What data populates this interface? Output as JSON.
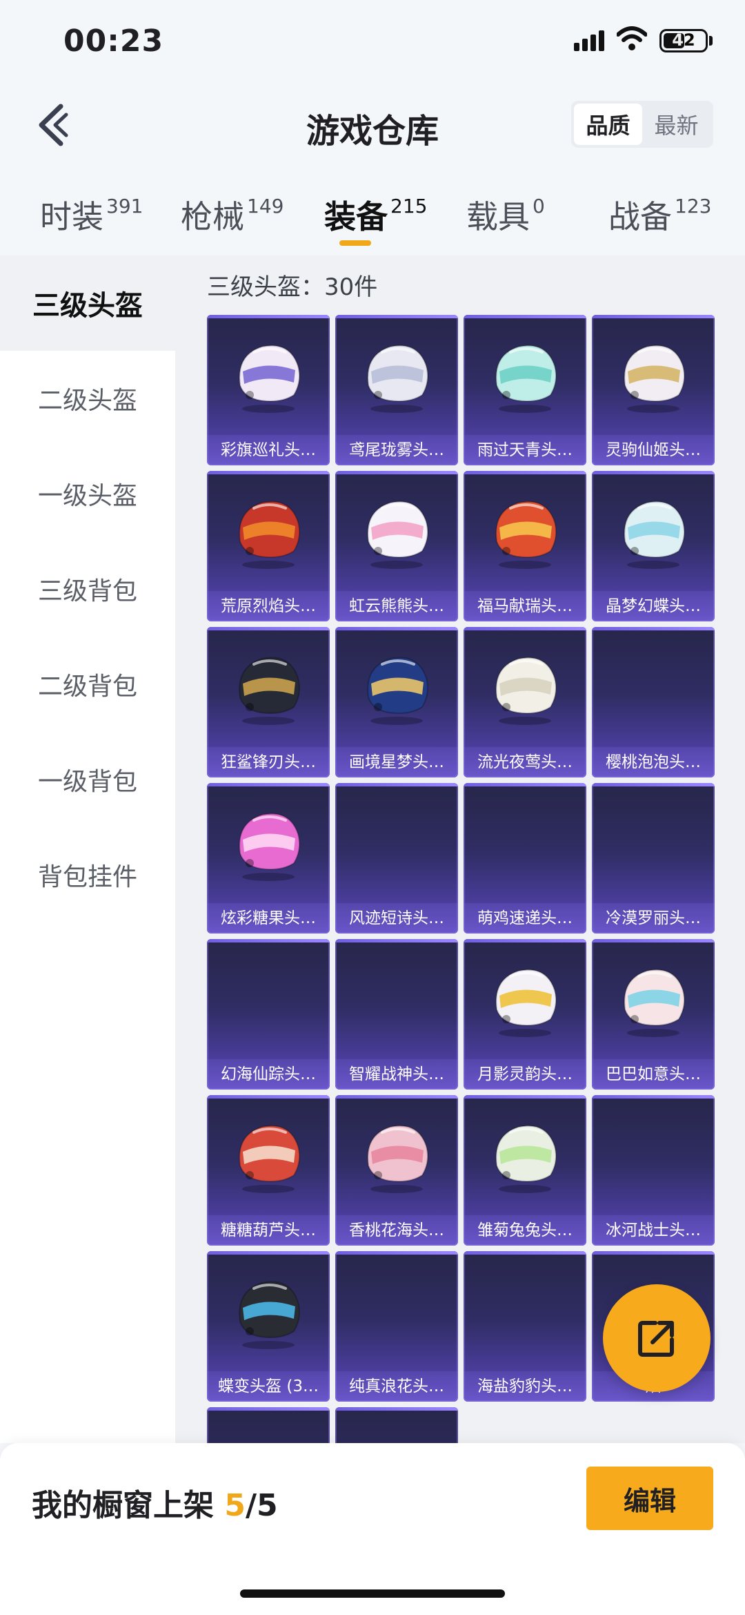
{
  "status": {
    "time": "00:23",
    "battery": "42"
  },
  "header": {
    "title": "游戏仓库",
    "sort_options": [
      "品质",
      "最新"
    ]
  },
  "tabs": [
    {
      "label": "时装",
      "count": "391"
    },
    {
      "label": "枪械",
      "count": "149"
    },
    {
      "label": "装备",
      "count": "215"
    },
    {
      "label": "载具",
      "count": "0"
    },
    {
      "label": "战备",
      "count": "123"
    }
  ],
  "sidebar": [
    "三级头盔",
    "二级头盔",
    "一级头盔",
    "三级背包",
    "二级背包",
    "一级背包",
    "背包挂件"
  ],
  "main": {
    "count_label": "三级头盔：30件"
  },
  "items": [
    {
      "name": "彩旗巡礼头…",
      "icon": "helmet-icon",
      "color": "#f2e9f7",
      "accent": "#7b6ad1"
    },
    {
      "name": "鸢尾珑雾头…",
      "icon": "helmet-icon",
      "color": "#e7e8f2",
      "accent": "#b8bfd8"
    },
    {
      "name": "雨过天青头…",
      "icon": "helmet-icon",
      "color": "#bfeee8",
      "accent": "#6ed0c6"
    },
    {
      "name": "灵驹仙姬头…",
      "icon": "helmet-icon",
      "color": "#f1edf2",
      "accent": "#d6b56a"
    },
    {
      "name": "荒原烈焰头…",
      "icon": "helmet-icon",
      "color": "#c8382a",
      "accent": "#f08a2a"
    },
    {
      "name": "虹云熊熊头…",
      "icon": "helmet-icon",
      "color": "#f7f3fb",
      "accent": "#f3a4c6"
    },
    {
      "name": "福马献瑞头…",
      "icon": "helmet-icon",
      "color": "#e1502e",
      "accent": "#f7c24a"
    },
    {
      "name": "晶梦幻蝶头…",
      "icon": "helmet-icon",
      "color": "#dff0f4",
      "accent": "#8fd6e8"
    },
    {
      "name": "狂鲨锋刃头…",
      "icon": "helmet-icon",
      "color": "#262a36",
      "accent": "#c9a14e"
    },
    {
      "name": "画境星梦头…",
      "icon": "helmet-icon",
      "color": "#223c86",
      "accent": "#e8c46a"
    },
    {
      "name": "流光夜莺头…",
      "icon": "helmet-icon",
      "color": "#f2efe6",
      "accent": "#d8d2c0"
    },
    {
      "name": "樱桃泡泡头…",
      "icon": "",
      "color": "",
      "accent": ""
    },
    {
      "name": "炫彩糖果头…",
      "icon": "helmet-icon",
      "color": "#e86bd1",
      "accent": "#ffd6f2"
    },
    {
      "name": "风迹短诗头…",
      "icon": "",
      "color": "",
      "accent": ""
    },
    {
      "name": "萌鸡速递头…",
      "icon": "",
      "color": "",
      "accent": ""
    },
    {
      "name": "冷漠罗丽头…",
      "icon": "",
      "color": "",
      "accent": ""
    },
    {
      "name": "幻海仙踪头…",
      "icon": "",
      "color": "",
      "accent": ""
    },
    {
      "name": "智耀战神头…",
      "icon": "",
      "color": "",
      "accent": ""
    },
    {
      "name": "月影灵韵头…",
      "icon": "helmet-icon",
      "color": "#f3f0f6",
      "accent": "#f0c23c"
    },
    {
      "name": "巴巴如意头…",
      "icon": "helmet-icon",
      "color": "#f6e4e6",
      "accent": "#7fd3e6"
    },
    {
      "name": "糖糖葫芦头…",
      "icon": "helmet-icon",
      "color": "#d94a3a",
      "accent": "#f5d9c9"
    },
    {
      "name": "香桃花海头…",
      "icon": "helmet-icon",
      "color": "#f0c2cf",
      "accent": "#e7879f"
    },
    {
      "name": "雏菊兔兔头…",
      "icon": "helmet-icon",
      "color": "#e9efe2",
      "accent": "#b9e59a"
    },
    {
      "name": "冰河战士头…",
      "icon": "",
      "color": "",
      "accent": ""
    },
    {
      "name": "蝶变头盔 (3…",
      "icon": "helmet-icon",
      "color": "#2a2c33",
      "accent": "#4ab6e6"
    },
    {
      "name": "纯真浪花头…",
      "icon": "",
      "color": "",
      "accent": ""
    },
    {
      "name": "海盐豹豹头…",
      "icon": "",
      "color": "",
      "accent": ""
    },
    {
      "name": "焰",
      "icon": "",
      "color": "",
      "accent": ""
    },
    {
      "name": "",
      "icon": "",
      "color": "",
      "accent": ""
    },
    {
      "name": "",
      "icon": "",
      "color": "",
      "accent": ""
    }
  ],
  "bottom": {
    "shelf_label": "我的橱窗上架",
    "shelf_count": "5",
    "shelf_total": "/5",
    "edit_label": "编辑"
  },
  "colors": {
    "accent": "#f6aa1c"
  }
}
